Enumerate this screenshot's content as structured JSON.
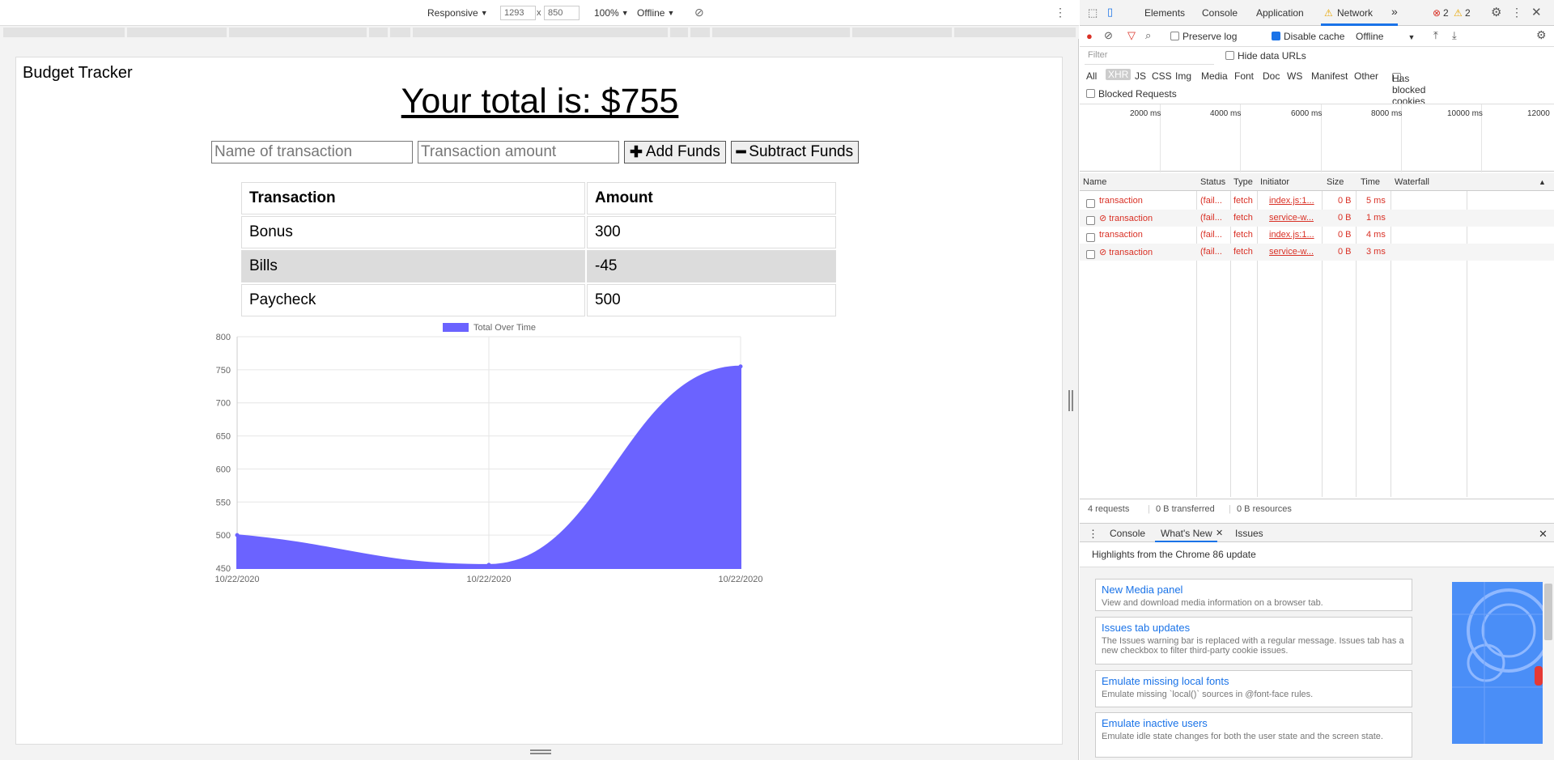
{
  "device_toolbar": {
    "device": "Responsive",
    "width": "1293",
    "separator": "x",
    "height": "850",
    "zoom": "100%",
    "throttle": "Offline"
  },
  "app": {
    "title": "Budget Tracker",
    "total_text": "Your total is: $755",
    "name_placeholder": "Name of transaction",
    "amount_placeholder": "Transaction amount",
    "add_label": "Add Funds",
    "subtract_label": "Subtract Funds",
    "table_headers": [
      "Transaction",
      "Amount"
    ],
    "transactions": [
      {
        "name": "Bonus",
        "amount": "300"
      },
      {
        "name": "Bills",
        "amount": "-45"
      },
      {
        "name": "Paycheck",
        "amount": "500"
      }
    ]
  },
  "chart_data": {
    "type": "area",
    "legend": [
      "Total Over Time"
    ],
    "legend_position": "top",
    "x": [
      "10/22/2020",
      "10/22/2020",
      "10/22/2020"
    ],
    "series": [
      {
        "name": "Total Over Time",
        "values": [
          500,
          455,
          755
        ]
      }
    ],
    "ylim": [
      450,
      800
    ],
    "yticks": [
      450,
      500,
      550,
      600,
      650,
      700,
      750,
      800
    ],
    "grid": true,
    "color": "#6b63ff"
  },
  "devtools": {
    "tabs": [
      "Elements",
      "Console",
      "Application",
      "Network"
    ],
    "active_tab": "Network",
    "more_tabs": "»",
    "error_count": "2",
    "warning_count": "2",
    "toolbar": {
      "preserve_log": "Preserve log",
      "disable_cache": "Disable cache",
      "throttle": "Offline"
    },
    "filter_placeholder": "Filter",
    "hide_data_urls": "Hide data URLs",
    "types": [
      "All",
      "XHR",
      "JS",
      "CSS",
      "Img",
      "Media",
      "Font",
      "Doc",
      "WS",
      "Manifest",
      "Other"
    ],
    "has_blocked_cookies": "Has blocked cookies",
    "blocked_requests": "Blocked Requests",
    "timeline_ticks": [
      "2000 ms",
      "4000 ms",
      "6000 ms",
      "8000 ms",
      "10000 ms",
      "12000"
    ],
    "columns": [
      "Name",
      "Status",
      "Type",
      "Initiator",
      "Size",
      "Time",
      "Waterfall"
    ],
    "requests": [
      {
        "name": "transaction",
        "status": "(fail...",
        "type": "fetch",
        "initiator": "index.js:1...",
        "size": "0 B",
        "time": "5 ms"
      },
      {
        "name": "⊘ transaction",
        "status": "(fail...",
        "type": "fetch",
        "initiator": "service-w...",
        "size": "0 B",
        "time": "1 ms"
      },
      {
        "name": "transaction",
        "status": "(fail...",
        "type": "fetch",
        "initiator": "index.js:1...",
        "size": "0 B",
        "time": "4 ms"
      },
      {
        "name": "⊘ transaction",
        "status": "(fail...",
        "type": "fetch",
        "initiator": "service-w...",
        "size": "0 B",
        "time": "3 ms"
      }
    ],
    "status_bar": [
      "4 requests",
      "0 B transferred",
      "0 B resources"
    ],
    "drawer_tabs": [
      "Console",
      "What's New",
      "Issues"
    ],
    "highlights": "Highlights from the Chrome 86 update",
    "cards": [
      {
        "title": "New Media panel",
        "desc": "View and download media information on a browser tab."
      },
      {
        "title": "Issues tab updates",
        "desc": "The Issues warning bar is replaced with a regular message. Issues tab has a new checkbox to filter third-party cookie issues."
      },
      {
        "title": "Emulate missing local fonts",
        "desc": "Emulate missing `local()` sources in @font-face rules."
      },
      {
        "title": "Emulate inactive users",
        "desc": "Emulate idle state changes for both the user state and the screen state."
      }
    ]
  }
}
